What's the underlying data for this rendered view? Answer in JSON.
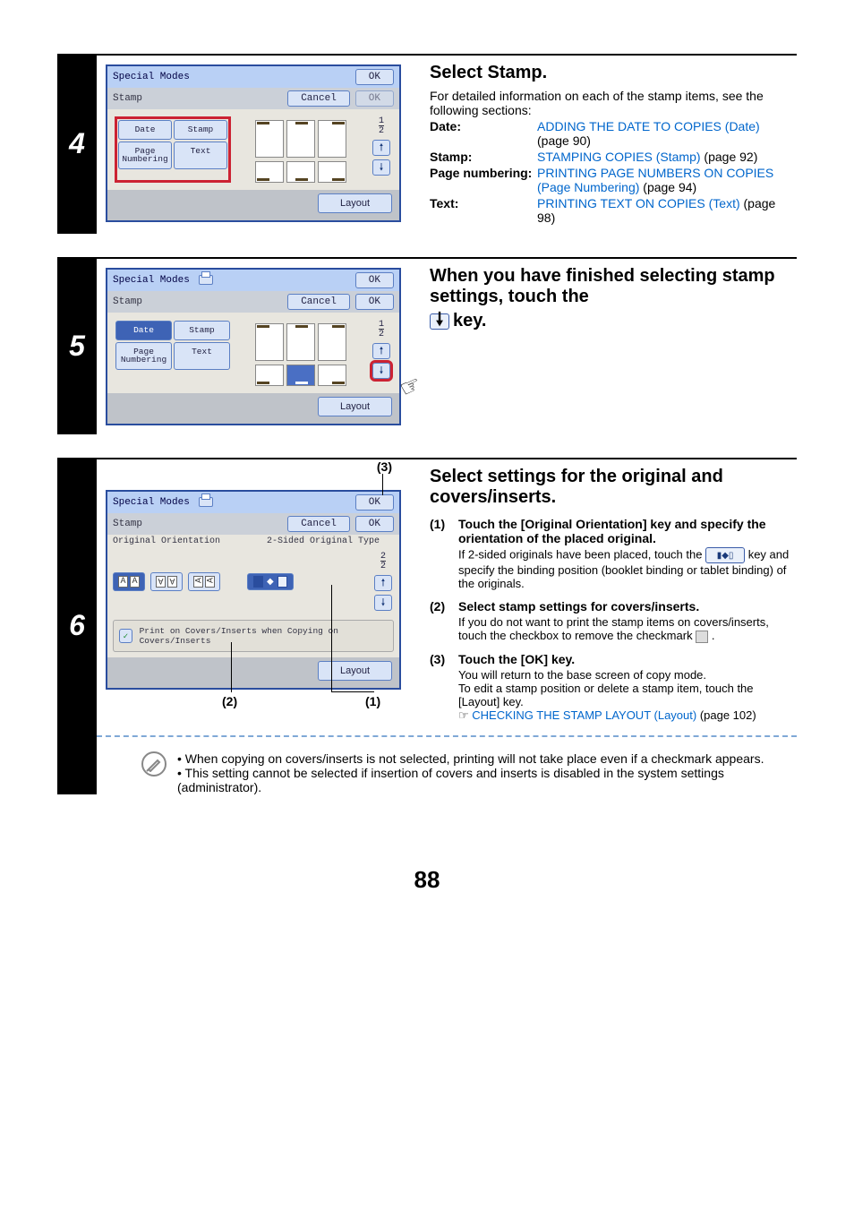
{
  "steps": {
    "s4": {
      "num": "4",
      "title": "Select Stamp.",
      "intro": "For detailed information on each of the stamp items, see the following sections:",
      "items": [
        {
          "label": "Date:",
          "link": "ADDING THE DATE TO COPIES (Date)",
          "suffix": " (page 90)"
        },
        {
          "label": "Stamp:",
          "link": "STAMPING COPIES (Stamp)",
          "suffix": " (page 92)"
        },
        {
          "label": "Page numbering:",
          "link": "PRINTING PAGE NUMBERS ON COPIES (Page Numbering)",
          "suffix": " (page 94)"
        },
        {
          "label": "Text:",
          "link": "PRINTING TEXT ON COPIES (Text)",
          "suffix": " (page 98)"
        }
      ],
      "lcd": {
        "top": "Special Modes",
        "top_ok": "OK",
        "sub_left": "Stamp",
        "sub_cancel": "Cancel",
        "sub_ok": "OK",
        "tabs": [
          "Date",
          "Stamp",
          "Page Numbering",
          "Text"
        ],
        "page": "1",
        "pages": "2",
        "layout": "Layout"
      }
    },
    "s5": {
      "num": "5",
      "title_a": "When you have finished selecting stamp settings, touch the ",
      "title_b": " key.",
      "lcd": {
        "top": "Special Modes",
        "top_ok": "OK",
        "sub_left": "Stamp",
        "sub_cancel": "Cancel",
        "sub_ok": "OK",
        "tabs": [
          "Date",
          "Stamp",
          "Page Numbering",
          "Text"
        ],
        "page": "1",
        "pages": "2",
        "layout": "Layout"
      }
    },
    "s6": {
      "num": "6",
      "title": "Select settings for the original and covers/inserts.",
      "subs": {
        "s1": {
          "num": "(1)",
          "head": "Touch the [Original Orientation] key and specify the orientation of the placed original.",
          "body_a": "If 2-sided originals have been placed, touch the ",
          "body_b": " key and specify the binding position (booklet binding or tablet binding) of the originals."
        },
        "s2": {
          "num": "(2)",
          "head": "Select stamp settings for covers/inserts.",
          "body_a": "If you do not want to print the stamp items on covers/inserts, touch the checkbox to remove the checkmark ",
          "body_b": "."
        },
        "s3": {
          "num": "(3)",
          "head": "Touch the [OK] key.",
          "line1": "You will return to the base screen of copy mode.",
          "line2": "To edit a stamp position or delete a stamp item, touch the [Layout] key.",
          "cref": "☞",
          "link": "CHECKING THE STAMP LAYOUT (Layout)",
          "suffix": " (page 102)"
        }
      },
      "callouts": {
        "c1": "(1)",
        "c2": "(2)",
        "c3": "(3)"
      },
      "lcd": {
        "top": "Special Modes",
        "top_ok": "OK",
        "sub_left": "Stamp",
        "sub_cancel": "Cancel",
        "sub_ok": "OK",
        "orient_label": "Original Orientation",
        "two_sided_label": "2-Sided Original Type",
        "chk_label": "Print on Covers/Inserts when Copying on Covers/Inserts",
        "page": "2",
        "pages": "2",
        "layout": "Layout"
      }
    }
  },
  "notes": {
    "n1": "When copying on covers/inserts is not selected, printing will not take place even if a checkmark appears.",
    "n2": "This setting cannot be selected if insertion of covers and inserts is disabled in the system settings (administrator)."
  },
  "page_number": "88"
}
